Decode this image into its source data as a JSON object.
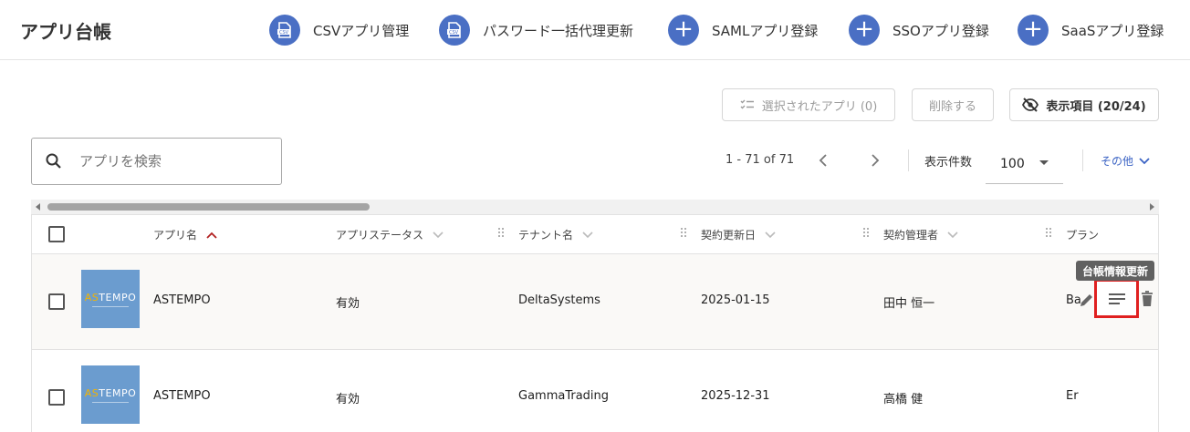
{
  "header": {
    "title": "アプリ台帳",
    "actions": [
      {
        "label": "CSVアプリ管理",
        "icon": "csv-file-icon"
      },
      {
        "label": "パスワード一括代理更新",
        "icon": "csv-file-icon"
      },
      {
        "label": "SAMLアプリ登録",
        "icon": "plus-icon"
      },
      {
        "label": "SSOアプリ登録",
        "icon": "plus-icon"
      },
      {
        "label": "SaaSアプリ登録",
        "icon": "plus-icon"
      }
    ],
    "csv_badge": "CSV"
  },
  "toolbar": {
    "selected_apps": "選択されたアプリ (0)",
    "delete": "削除する",
    "display_items": "表示項目 (20/24)"
  },
  "search": {
    "placeholder": "アプリを検索"
  },
  "pagination": {
    "range": "1 - 71 of 71",
    "per_page_label": "表示件数",
    "per_page_value": "100",
    "more": "その他"
  },
  "table": {
    "columns": [
      "アプリ名",
      "アプリステータス",
      "テナント名",
      "契約更新日",
      "契約管理者",
      "プラン"
    ],
    "rows": [
      {
        "logo": "ASTEMPO",
        "name": "ASTEMPO",
        "status": "有効",
        "tenant": "DeltaSystems",
        "renewal": "2025-01-15",
        "manager": "田中 恒一",
        "plan": "Ba"
      },
      {
        "logo": "ASTEMPO",
        "name": "ASTEMPO",
        "status": "有効",
        "tenant": "GammaTrading",
        "renewal": "2025-12-31",
        "manager": "高橋 健",
        "plan": "Er"
      }
    ],
    "tooltip": "台帳情報更新"
  },
  "colors": {
    "accent": "#4a6fc4",
    "link": "#3b63c4",
    "sort_active": "#b22222",
    "highlight": "#e02020",
    "logo_bg": "#6b9ccf",
    "logo_accent": "#f4b400"
  }
}
